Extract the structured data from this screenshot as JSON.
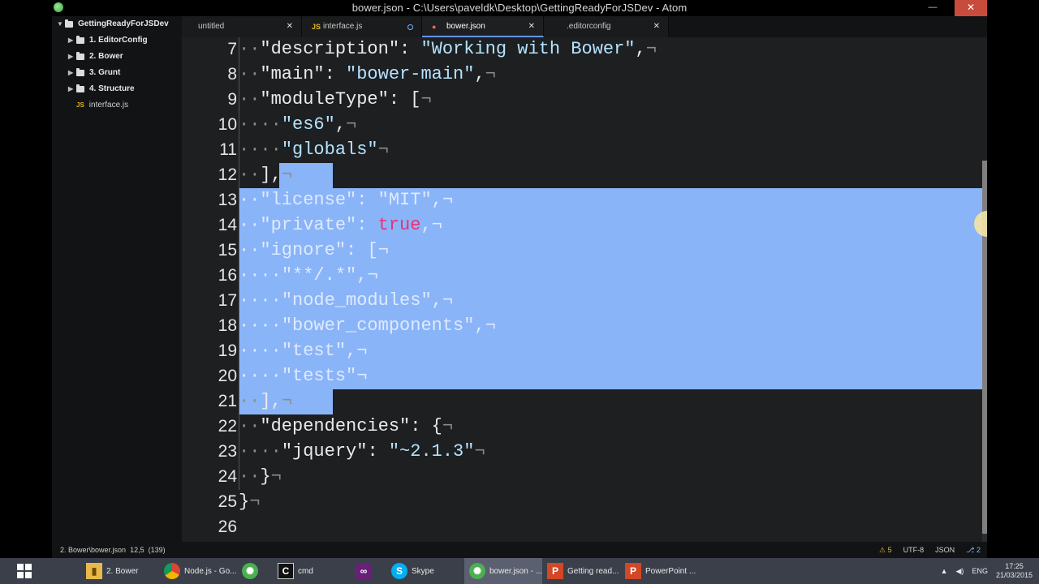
{
  "window": {
    "title": "bower.json - C:\\Users\\paveldk\\Desktop\\GettingReadyForJSDev - Atom"
  },
  "controls": {
    "minimize": "—",
    "maximize": "▭",
    "close": "✕"
  },
  "sidebar": {
    "project": "GettingReadyForJSDev",
    "items": [
      {
        "label": "1. EditorConfig",
        "arrow": "▶"
      },
      {
        "label": "2. Bower",
        "arrow": "▶"
      },
      {
        "label": "3. Grunt",
        "arrow": "▶"
      },
      {
        "label": "4. Structure",
        "arrow": "▶"
      }
    ],
    "root_arrow": "▼",
    "file": {
      "badge": "JS",
      "label": "interface.js"
    }
  },
  "tabs": [
    {
      "label": "untitled",
      "close": "✕"
    },
    {
      "label": "interface.js",
      "badge": "JS"
    },
    {
      "label": "bower.json",
      "close": "✕"
    },
    {
      "label": ".editorconfig",
      "close": "✕"
    }
  ],
  "editor": {
    "lines": [
      {
        "n": "7",
        "text": "··\"description\": \"Working with Bower\",¬"
      },
      {
        "n": "8",
        "text": "··\"main\": \"bower-main\",¬"
      },
      {
        "n": "9",
        "text": "··\"moduleType\": [¬"
      },
      {
        "n": "10",
        "text": "····\"es6\",¬"
      },
      {
        "n": "11",
        "text": "····\"globals\"¬"
      },
      {
        "n": "12",
        "text": "··],¬"
      },
      {
        "n": "13",
        "text": "··\"license\": \"MIT\",¬"
      },
      {
        "n": "14",
        "text": "··\"private\": true,¬"
      },
      {
        "n": "15",
        "text": "··\"ignore\": [¬"
      },
      {
        "n": "16",
        "text": "····\"**/.*\",¬"
      },
      {
        "n": "17",
        "text": "····\"node_modules\",¬"
      },
      {
        "n": "18",
        "text": "····\"bower_components\",¬"
      },
      {
        "n": "19",
        "text": "····\"test\",¬"
      },
      {
        "n": "20",
        "text": "····\"tests\"¬"
      },
      {
        "n": "21",
        "text": "··],¬"
      },
      {
        "n": "22",
        "text": "··\"dependencies\": {¬"
      },
      {
        "n": "23",
        "text": "····\"jquery\": \"~2.1.3\"¬"
      },
      {
        "n": "24",
        "text": "··}¬"
      },
      {
        "n": "25",
        "text": "}¬"
      },
      {
        "n": "26",
        "text": ""
      }
    ]
  },
  "status": {
    "path": "2. Bower\\bower.json",
    "cursor": "12,5",
    "selection": "(139)",
    "warnings": "⚠ 5",
    "encoding": "UTF-8",
    "grammar": "JSON",
    "git": "2"
  },
  "taskbar": {
    "items": [
      {
        "label": "2. Bower"
      },
      {
        "label": "Node.js - Go..."
      },
      {
        "label": ""
      },
      {
        "label": "cmd"
      },
      {
        "label": ""
      },
      {
        "label": "Skype"
      },
      {
        "label": "bower.json - ..."
      },
      {
        "label": "Getting read..."
      },
      {
        "label": "PowerPoint ..."
      }
    ],
    "lang": "ENG",
    "time": "17:25",
    "date": "21/03/2015"
  },
  "colors": {
    "accent": "#6494ed",
    "selection": "#8ab4f8",
    "bool": "#e6337a",
    "string": "#b5e2ff"
  }
}
